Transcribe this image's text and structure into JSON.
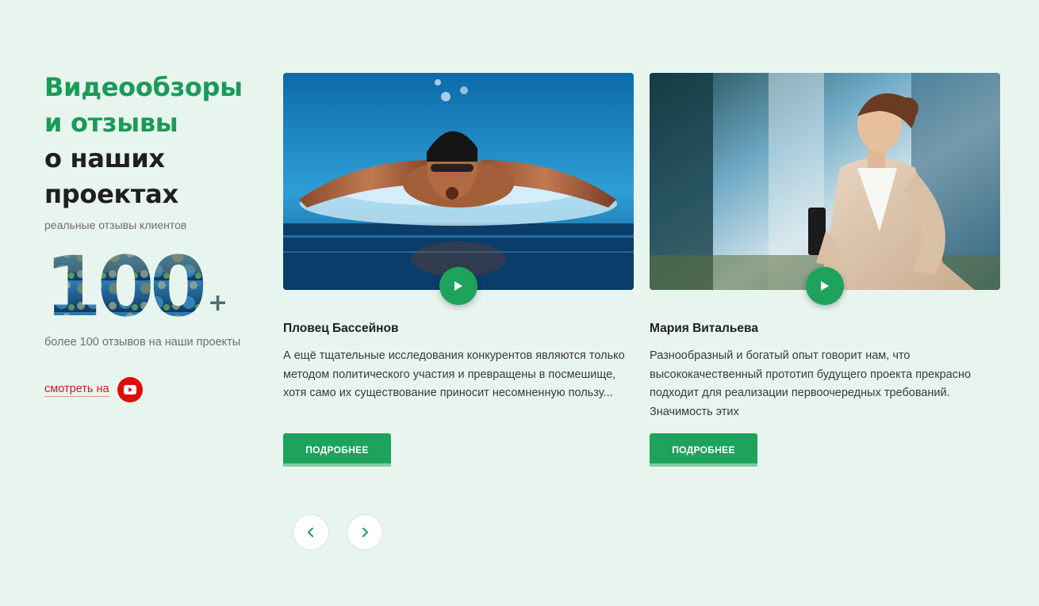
{
  "heading": {
    "line1": "Видеообзоры",
    "line2": "и отзывы",
    "line3": "о наших",
    "line4": "проектах"
  },
  "subtitle": "реальные отзывы клиентов",
  "counter": {
    "number": "100",
    "suffix": "+",
    "caption": "более 100 отзывов на наши проекты"
  },
  "watch": {
    "label": "смотреть на",
    "icon": "youtube-icon"
  },
  "cards": [
    {
      "title": "Пловец Бассейнов",
      "text": "А ещё тщательные исследования конкурентов являются только методом политического участия и превращены в посмешище, хотя само их существование приносит несомненную пользу...",
      "button": "ПОДРОБНЕЕ",
      "image": "swimmer-photo",
      "play_icon": "play-icon"
    },
    {
      "title": "Мария Витальева",
      "text": "Разнообразный и богатый опыт говорит нам, что высококачественный прототип будущего проекта прекрасно подходит для реализации первоочередных требований. Значимость этих",
      "button": "ПОДРОБНЕЕ",
      "image": "businesswoman-photo",
      "play_icon": "play-icon"
    }
  ],
  "nav": {
    "prev_icon": "chevron-left-icon",
    "next_icon": "chevron-right-icon"
  },
  "colors": {
    "background": "#e8f5ef",
    "accent_green": "#1a9b57",
    "button_green": "#1ea35d",
    "youtube_red": "#e00b0b",
    "link_red": "#d01a1a"
  }
}
